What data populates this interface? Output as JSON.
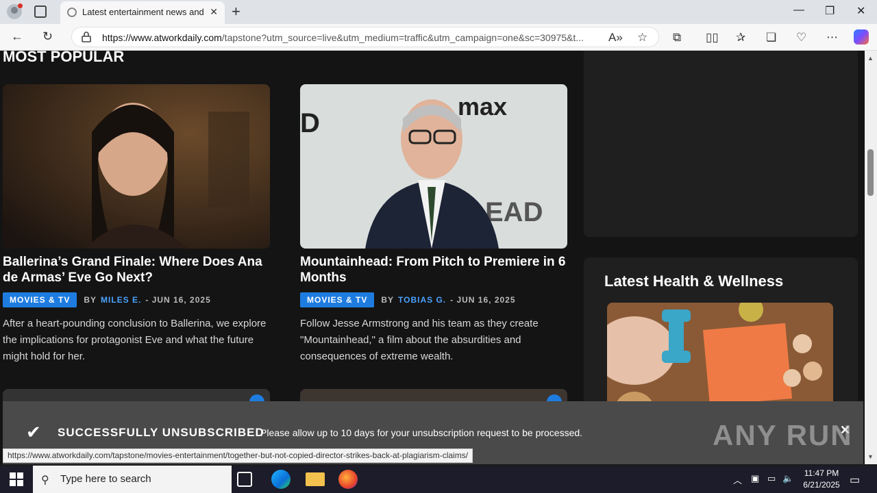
{
  "browser": {
    "tab_title": "Latest entertainment news and re",
    "url_domain": "https://www.atworkdaily.com",
    "url_path": "/tapstone?utm_source=live&utm_medium=traffic&utm_campaign=one&sc=30975&t...",
    "status_url": "https://www.atworkdaily.com/tapstone/movies-entertainment/together-but-not-copied-director-strikes-back-at-plagiarism-claims/"
  },
  "page": {
    "section_title": "MOST POPULAR",
    "articles": [
      {
        "title": "Ballerina’s Grand Finale: Where Does Ana de Armas’ Eve Go Next?",
        "category": "MOVIES & TV",
        "by": "BY",
        "author": "MILES E.",
        "date": "- JUN 16, 2025",
        "excerpt": "After a heart-pounding conclusion to Ballerina, we explore the implications for protagonist Eve and what the future might hold for her."
      },
      {
        "title": "Mountainhead: From Pitch to Premiere in 6 Months",
        "category": "MOVIES & TV",
        "by": "BY",
        "author": "TOBIAS G.",
        "date": "- JUN 16, 2025",
        "excerpt": "Follow Jesse Armstrong and his team as they create \"Mountainhead,\" a film about the absurdities and consequences of extreme wealth."
      }
    ],
    "sidebar_title": "Latest Health & Wellness"
  },
  "notice": {
    "heading": "SUCCESSFULLY UNSUBSCRIBED",
    "message": "Please allow up to 10 days for your unsubscription request to be processed.",
    "close": "✕"
  },
  "watermark": "ANY RUN",
  "taskbar": {
    "search_placeholder": "Type here to search",
    "time": "11:47 PM",
    "date": "6/21/2025"
  }
}
